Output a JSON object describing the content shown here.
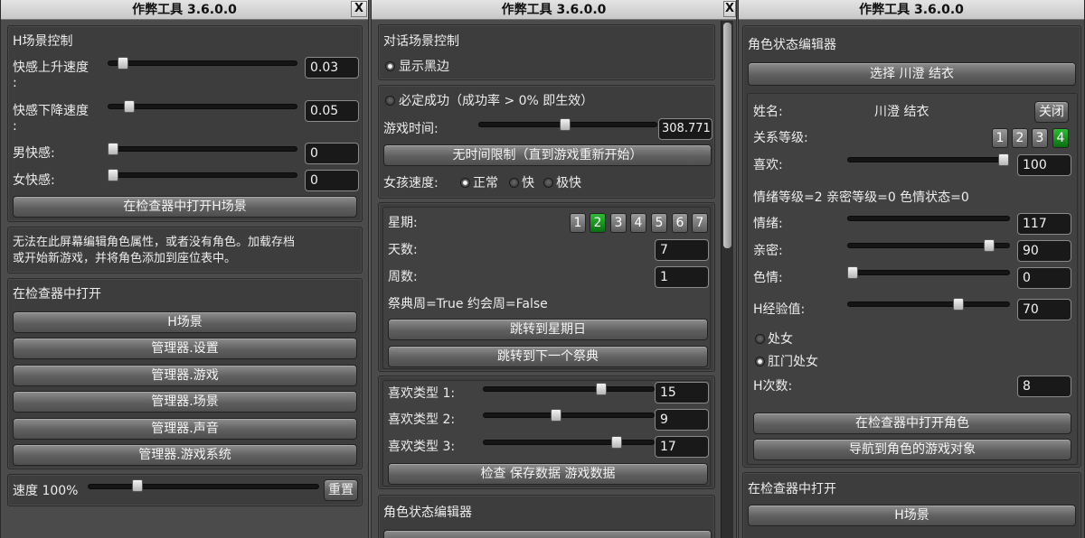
{
  "app_title": "作弊工具 3.6.0.0",
  "close_label": "X",
  "w1": {
    "h_scene": {
      "title": "H场景控制",
      "rise_label": "快感上升速度",
      "rise_colon": ":",
      "rise_value": "0.03",
      "fall_label": "快感下降速度",
      "fall_colon": ":",
      "fall_value": "0.05",
      "male_label": "男快感:",
      "male_value": "0",
      "female_label": "女快感:",
      "female_value": "0",
      "open_button": "在检查器中打开H场景"
    },
    "notice": {
      "line1": "无法在此屏幕编辑角色属性，或者没有角色。加载存档",
      "line2": "或开始新游戏，并将角色添加到座位表中。"
    },
    "inspector": {
      "title": "在检查器中打开",
      "buttons": [
        "H场景",
        "管理器.设置",
        "管理器.游戏",
        "管理器.场景",
        "管理器.声音",
        "管理器.游戏系统"
      ]
    },
    "speed": {
      "label": "速度 100%",
      "reset": "重置"
    }
  },
  "w2": {
    "dialog": {
      "title": "对话场景控制",
      "black_border": "显示黑边"
    },
    "success": {
      "label": "必定成功（成功率 > 0% 即生效）",
      "time_label": "游戏时间:",
      "time_value": "308.771",
      "no_limit_button": "无时间限制（直到游戏重新开始）",
      "girl_speed_label": "女孩速度:",
      "speed_options": [
        "正常",
        "快",
        "极快"
      ]
    },
    "calendar": {
      "week_label": "星期:",
      "days": [
        "1",
        "2",
        "3",
        "4",
        "5",
        "6",
        "7"
      ],
      "day_label": "天数:",
      "day_value": "7",
      "week_count_label": "周数:",
      "week_count_value": "1",
      "festival_line": "祭典周=True  约会周=False",
      "jump_sunday": "跳转到星期日",
      "jump_festival": "跳转到下一个祭典"
    },
    "likes": {
      "type1_label": "喜欢类型 1:",
      "type1_value": "15",
      "type2_label": "喜欢类型 2:",
      "type2_value": "9",
      "type3_label": "喜欢类型 3:",
      "type3_value": "17",
      "check_button": "检查 保存数据 游戏数据"
    },
    "char_editor_title": "角色状态编辑器"
  },
  "w3": {
    "editor_title": "角色状态编辑器",
    "select_button": "选择 川澄 结衣",
    "name_label": "姓名:",
    "name_value": "川澄 结衣",
    "close_button": "关闭",
    "relation_label": "关系等级:",
    "relation_levels": [
      "1",
      "2",
      "3",
      "4"
    ],
    "like_label": "喜欢:",
    "like_value": "100",
    "status_line": "情绪等级=2  亲密等级=0  色情状态=0",
    "emotion_label": "情绪:",
    "emotion_value": "117",
    "intimacy_label": "亲密:",
    "intimacy_value": "90",
    "lewd_label": "色情:",
    "lewd_value": "0",
    "hexp_label": "H经验值:",
    "hexp_value": "70",
    "virgin_label": "处女",
    "anal_virgin_label": "肛门处女",
    "hcount_label": "H次数:",
    "hcount_value": "8",
    "open_char_button": "在检查器中打开角色",
    "nav_button": "导航到角色的游戏对象",
    "inspector_title": "在检查器中打开",
    "h_scene_button": "H场景"
  }
}
